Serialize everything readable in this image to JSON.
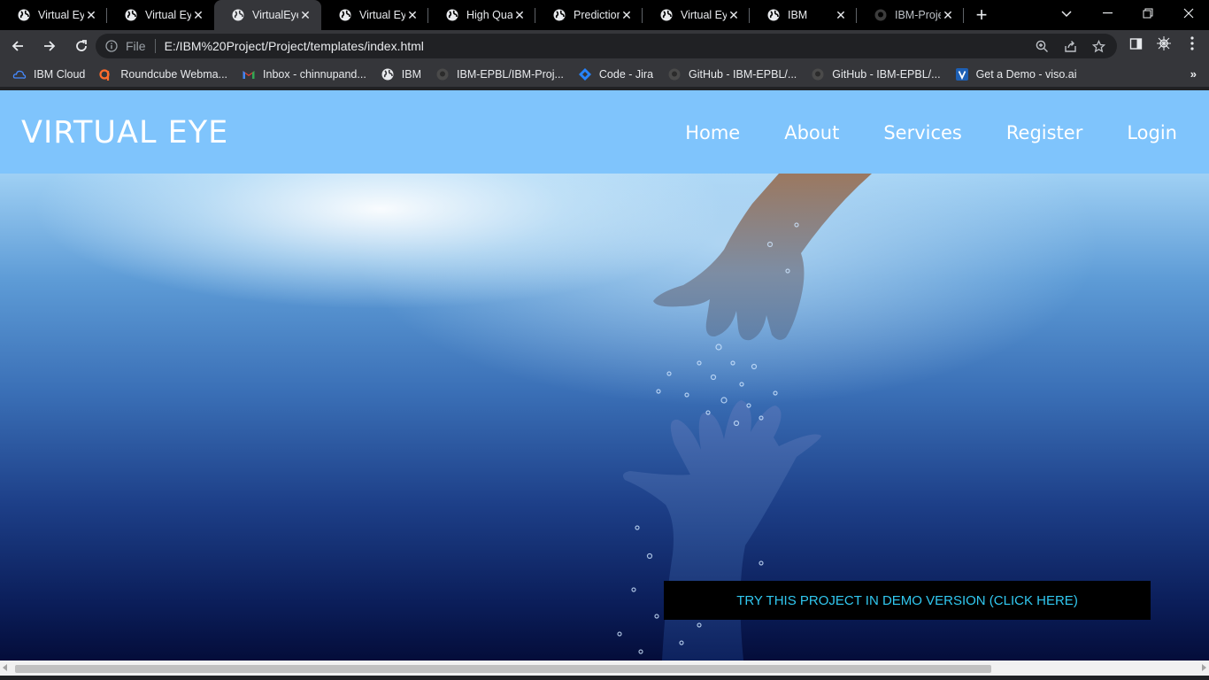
{
  "browser": {
    "tabs": [
      {
        "title": "Virtual Eye",
        "active": false,
        "icon": "globe-icon"
      },
      {
        "title": "Virtual Eye",
        "active": false,
        "icon": "globe-icon"
      },
      {
        "title": "VirtualEye",
        "active": true,
        "icon": "globe-icon"
      },
      {
        "title": "Virtual Eye",
        "active": false,
        "icon": "globe-icon"
      },
      {
        "title": "High Quali",
        "active": false,
        "icon": "globe-icon"
      },
      {
        "title": "Prediction",
        "active": false,
        "icon": "globe-icon"
      },
      {
        "title": "Virtual Eye",
        "active": false,
        "icon": "globe-icon"
      },
      {
        "title": "IBM",
        "active": false,
        "icon": "globe-icon"
      },
      {
        "title": "IBM-Projec",
        "active": false,
        "icon": "github-icon"
      }
    ],
    "address": {
      "scheme_label": "File",
      "url": "E:/IBM%20Project/Project/templates/index.html"
    },
    "bookmarks": [
      {
        "label": "IBM Cloud",
        "icon": "ibm-cloud-icon"
      },
      {
        "label": "Roundcube Webma...",
        "icon": "cpanel-icon"
      },
      {
        "label": "Inbox - chinnupand...",
        "icon": "gmail-icon"
      },
      {
        "label": "IBM",
        "icon": "globe-icon"
      },
      {
        "label": "IBM-EPBL/IBM-Proj...",
        "icon": "github-icon"
      },
      {
        "label": "Code - Jira",
        "icon": "jira-icon"
      },
      {
        "label": "GitHub - IBM-EPBL/...",
        "icon": "github-icon"
      },
      {
        "label": "GitHub - IBM-EPBL/...",
        "icon": "github-icon"
      },
      {
        "label": "Get a Demo - viso.ai",
        "icon": "viso-icon"
      }
    ],
    "bookmarks_more": "»"
  },
  "site": {
    "brand": "VIRTUAL EYE",
    "nav": [
      "Home",
      "About",
      "Services",
      "Register",
      "Login"
    ],
    "demo_button": "TRY THIS PROJECT IN DEMO VERSION (CLICK HERE)"
  },
  "colors": {
    "header_bg": "#7fc4fc",
    "demo_text": "#31c8f0",
    "demo_bg": "#000000"
  }
}
